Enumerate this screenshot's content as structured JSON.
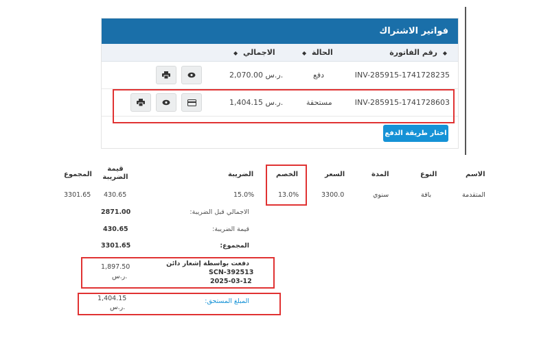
{
  "invoices": {
    "title": "فواتير الاشتراك",
    "columns": {
      "number": "رقم الفاتورة",
      "status": "الحالة",
      "total": "الاجمالي"
    },
    "rows": [
      {
        "number": "INV-285915-1741728235",
        "status": "دفع",
        "total": "2,070.00 ر.س."
      },
      {
        "number": "INV-285915-1741728603",
        "status": "مستحقة",
        "total": "1,404.15 ر.س."
      }
    ],
    "pay_button": "اختار طريقة الدفع"
  },
  "details": {
    "columns": {
      "name": "الاسم",
      "type": "النوع",
      "duration": "المدة",
      "price": "السعر",
      "discount": "الخصم",
      "tax": "الضريبة",
      "tax_value": "قيمة الضريبة",
      "total": "المجموع"
    },
    "item": {
      "name": "المتقدمة",
      "type": "باقة",
      "duration": "سنوي",
      "price": "3300.0",
      "discount": "13.0%",
      "tax": "15.0%",
      "tax_value": "430.65",
      "total": "3301.65"
    },
    "summary": {
      "before_tax_label": "الاجمالي قبل الضريبة:",
      "before_tax": "2871.00",
      "tax_label": "قيمة الضريبة:",
      "tax": "430.65",
      "total_label": "المجموع:",
      "total": "3301.65"
    },
    "payment": {
      "line1": "دفعت بواسطة إشعار دائن",
      "line2": "SCN-392513",
      "line3": "2025-03-12",
      "amount": "1,897.50",
      "currency": "ر.س."
    },
    "due": {
      "label": "المبلغ المستحق:",
      "amount": "1,404.15",
      "currency": "ر.س."
    }
  }
}
